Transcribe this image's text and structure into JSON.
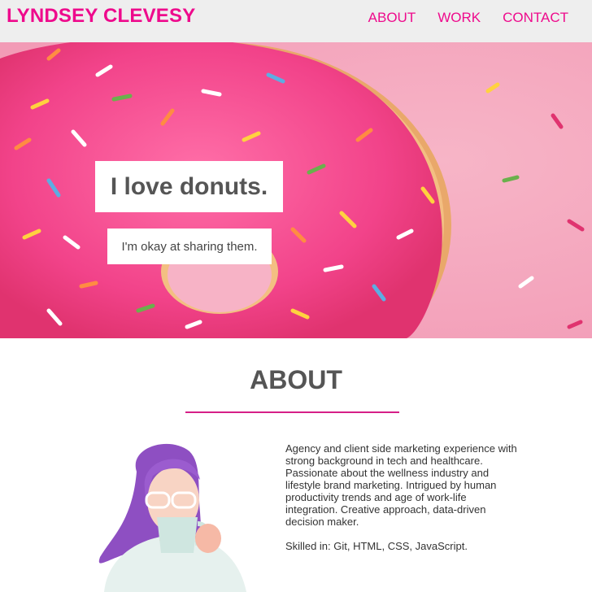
{
  "header": {
    "brand": "LYNDSEY CLEVESY",
    "nav": [
      {
        "label": "ABOUT"
      },
      {
        "label": "WORK"
      },
      {
        "label": "CONTACT"
      }
    ]
  },
  "hero": {
    "headline": "I love donuts.",
    "subheadline": "I'm okay at sharing them."
  },
  "about": {
    "title": "ABOUT",
    "bio": "Agency and client side marketing experience with strong background in tech and healthcare. Passionate about the wellness industry and lifestyle brand marketing. Intrigued by human productivity trends and age of work-life integration. Creative approach, data-driven decision maker.",
    "skills": "Skilled in: Git, HTML, CSS, JavaScript."
  },
  "colors": {
    "accent": "#ee0a8c",
    "nav_background": "#eeeeee",
    "hero_background": "#f4a6bd",
    "heading_text": "#555555"
  }
}
